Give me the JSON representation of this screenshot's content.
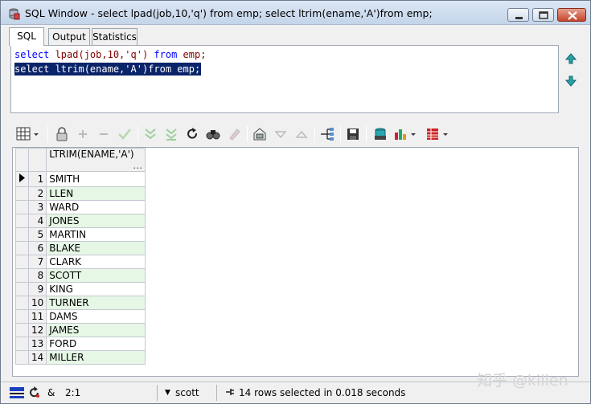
{
  "window": {
    "title": "SQL Window - select lpad(job,10,'q') from emp; select ltrim(ename,'A')from emp;"
  },
  "tabs": [
    {
      "label": "SQL",
      "active": true
    },
    {
      "label": "Output",
      "active": false
    },
    {
      "label": "Statistics",
      "active": false
    }
  ],
  "editor": {
    "line1": {
      "kw1": "select",
      "fn": " lpad(job,10,'q') ",
      "kw2": "from",
      "tbl": " emp;"
    },
    "line2": "select ltrim(ename,'A')from emp;"
  },
  "toolbar": {
    "icons": [
      "grid-icon",
      "lock-icon",
      "add-row-icon",
      "delete-row-icon",
      "post-icon",
      "fetch-next-icon",
      "fetch-last-icon",
      "refresh-icon",
      "find-icon",
      "clear-icon",
      "query-by-example-icon",
      "previous-record-icon",
      "next-record-icon",
      "link-icon",
      "save-icon",
      "export-icon",
      "chart-icon",
      "report-icon"
    ]
  },
  "grid": {
    "column": "LTRIM(ENAME,'A')",
    "rows": [
      {
        "n": "1",
        "v": "SMITH"
      },
      {
        "n": "2",
        "v": "LLEN"
      },
      {
        "n": "3",
        "v": "WARD"
      },
      {
        "n": "4",
        "v": "JONES"
      },
      {
        "n": "5",
        "v": "MARTIN"
      },
      {
        "n": "6",
        "v": "BLAKE"
      },
      {
        "n": "7",
        "v": "CLARK"
      },
      {
        "n": "8",
        "v": "SCOTT"
      },
      {
        "n": "9",
        "v": "KING"
      },
      {
        "n": "10",
        "v": "TURNER"
      },
      {
        "n": "11",
        "v": "DAMS"
      },
      {
        "n": "12",
        "v": "JAMES"
      },
      {
        "n": "13",
        "v": "FORD"
      },
      {
        "n": "14",
        "v": "MILLER"
      }
    ]
  },
  "status": {
    "amp": "&",
    "position": "2:1",
    "user": "scott",
    "message": "14 rows selected in 0.018 seconds"
  },
  "watermark": "知乎 @killen",
  "colors": {
    "selection": "#0a246a",
    "keyword": "#0000ff",
    "alt_row": "#e6f7e6"
  }
}
